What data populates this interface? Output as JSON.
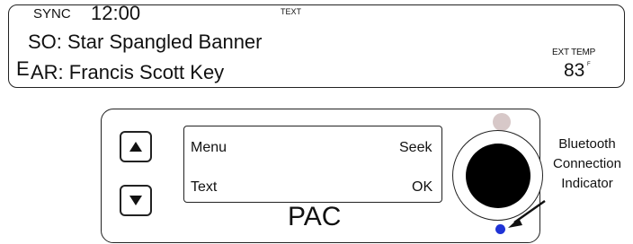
{
  "display": {
    "sync_label": "SYNC",
    "time": "12:00",
    "text_indicator": "TEXT",
    "song_line": "SO: Star Spangled Banner",
    "artist_line": "AR: Francis Scott Key",
    "direction": "E",
    "ext_temp_label": "EXT TEMP",
    "temperature": "83",
    "temperature_unit": "F"
  },
  "pac": {
    "up_button_icon": "up-arrow-icon",
    "down_button_icon": "down-arrow-icon",
    "screen": {
      "top_left": "Menu",
      "top_right": "Seek",
      "bottom_left": "Text",
      "bottom_right": "OK"
    },
    "label": "PAC",
    "colors": {
      "status_led": "#d7c8c8",
      "knob": "#000000",
      "bluetooth_led": "#1f33d6"
    }
  },
  "annotation": {
    "bluetooth_lines": [
      "Bluetooth",
      "Connection",
      "Indicator"
    ]
  }
}
